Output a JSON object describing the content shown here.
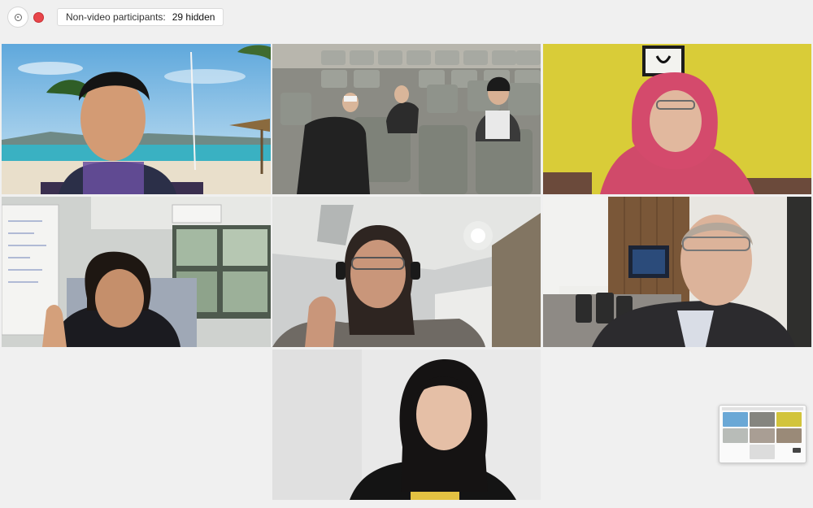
{
  "toolbar": {
    "info_icon": "info-icon",
    "record_icon": "record-icon",
    "non_video_label": "Non-video participants:",
    "hidden_count": "29 hidden"
  },
  "participants": [
    {
      "id": "p1",
      "background": "beach"
    },
    {
      "id": "p2",
      "background": "auditorium"
    },
    {
      "id": "p3",
      "background": "yellow-wall"
    },
    {
      "id": "p4",
      "background": "office-whiteboard"
    },
    {
      "id": "p5",
      "background": "ceiling-light"
    },
    {
      "id": "p6",
      "background": "wood-panel-room"
    },
    {
      "id": "p7",
      "background": "white-wall"
    }
  ],
  "colors": {
    "record": "#e8454a",
    "page_bg": "#f0f0f0"
  }
}
